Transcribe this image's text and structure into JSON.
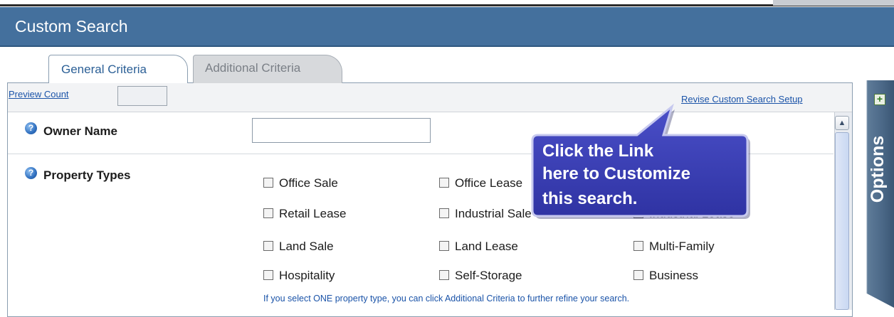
{
  "window": {
    "title": "Custom Search"
  },
  "tabs": [
    {
      "label": "General Criteria",
      "selected": true
    },
    {
      "label": "Additional Criteria",
      "selected": false
    }
  ],
  "toolbar": {
    "preview_count_label": "Preview Count",
    "preview_count_value": "",
    "revise_link": "Revise Custom Search Setup"
  },
  "owner": {
    "label": "Owner Name",
    "value": "",
    "placeholder": ""
  },
  "property_types": {
    "label": "Property Types",
    "options": [
      {
        "label": "Office Sale",
        "checked": false
      },
      {
        "label": "Office Lease",
        "checked": false
      },
      {
        "label": "Retail Lease",
        "checked": false
      },
      {
        "label": "Industrial Sale",
        "checked": false
      },
      {
        "label": "Industrial Lease",
        "checked": false
      },
      {
        "label": "Land Sale",
        "checked": false
      },
      {
        "label": "Land Lease",
        "checked": false
      },
      {
        "label": "Multi-Family",
        "checked": false
      },
      {
        "label": "Hospitality",
        "checked": false
      },
      {
        "label": "Self-Storage",
        "checked": false
      },
      {
        "label": "Business",
        "checked": false
      }
    ],
    "note": "If you select ONE property type, you can click Additional Criteria to further refine your search."
  },
  "callout": {
    "lines": [
      "Click the Link",
      "here to Customize",
      "this search."
    ]
  },
  "options_panel": {
    "label": "Options",
    "add_glyph": "+"
  },
  "icons": {
    "help": "help-icon",
    "scroll_up": "chevron-up-icon"
  },
  "colors": {
    "header_bg": "#44709d",
    "link": "#1a53a8",
    "callout_bg": "#3b3fb5"
  }
}
